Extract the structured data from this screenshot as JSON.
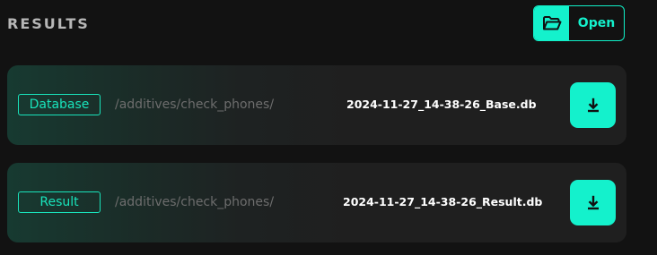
{
  "section": {
    "title": "RESULTS"
  },
  "open_button": {
    "label": "Open",
    "icon": "folder-open-icon"
  },
  "results": [
    {
      "tag": "Database",
      "path": "/additives/check_phones/",
      "filename": "2024-11-27_14-38-26_Base.db",
      "download_icon": "download-icon"
    },
    {
      "tag": "Result",
      "path": "/additives/check_phones/",
      "filename": "2024-11-27_14-38-26_Result.db",
      "download_icon": "download-icon"
    }
  ],
  "colors": {
    "background": "#121212",
    "accent": "#14f1cc",
    "row_background": "#1f1f1f",
    "row_gradient_start": "#173a31",
    "path_text": "#6d6d6d",
    "title_text": "#b7b7b7"
  }
}
